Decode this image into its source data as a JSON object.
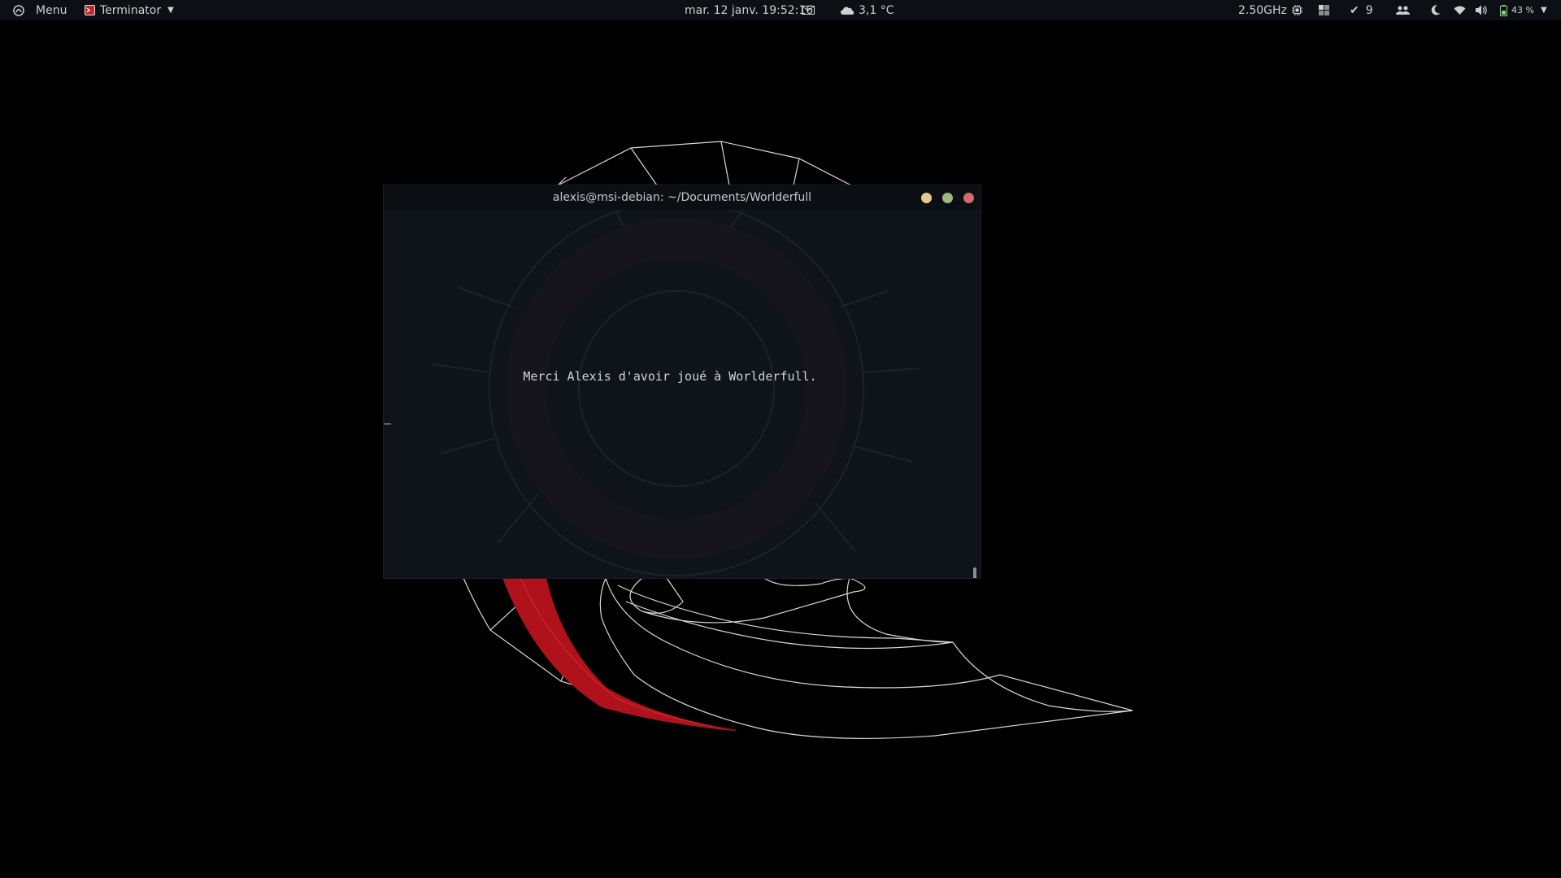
{
  "top_panel": {
    "menu_label": "Menu",
    "app_name": "Terminator",
    "clock": "mar. 12 janv.  19:52:16",
    "weather": "3,1 °C",
    "cpu_freq": "2.50GHz",
    "tasks_count": "9",
    "battery_percent": "43 %",
    "icons": [
      "menu-icon",
      "terminator-icon",
      "mail-icon",
      "weather-icon",
      "cpu-icon",
      "workspace-icon",
      "check-icon",
      "people-icon",
      "moon-icon",
      "wifi-icon",
      "volume-icon",
      "battery-icon"
    ]
  },
  "terminal": {
    "title": "alexis@msi-debian: ~/Documents/Worlderfull",
    "message": "Merci Alexis d'avoir joué à Worlderfull."
  },
  "colors": {
    "panel_bg": "#0c0f14",
    "terminal_bg": "#0f131a",
    "accent_red": "#b0121c",
    "btn_min": "#e3c98a",
    "btn_max": "#9fb883",
    "btn_close": "#d26b6b"
  }
}
